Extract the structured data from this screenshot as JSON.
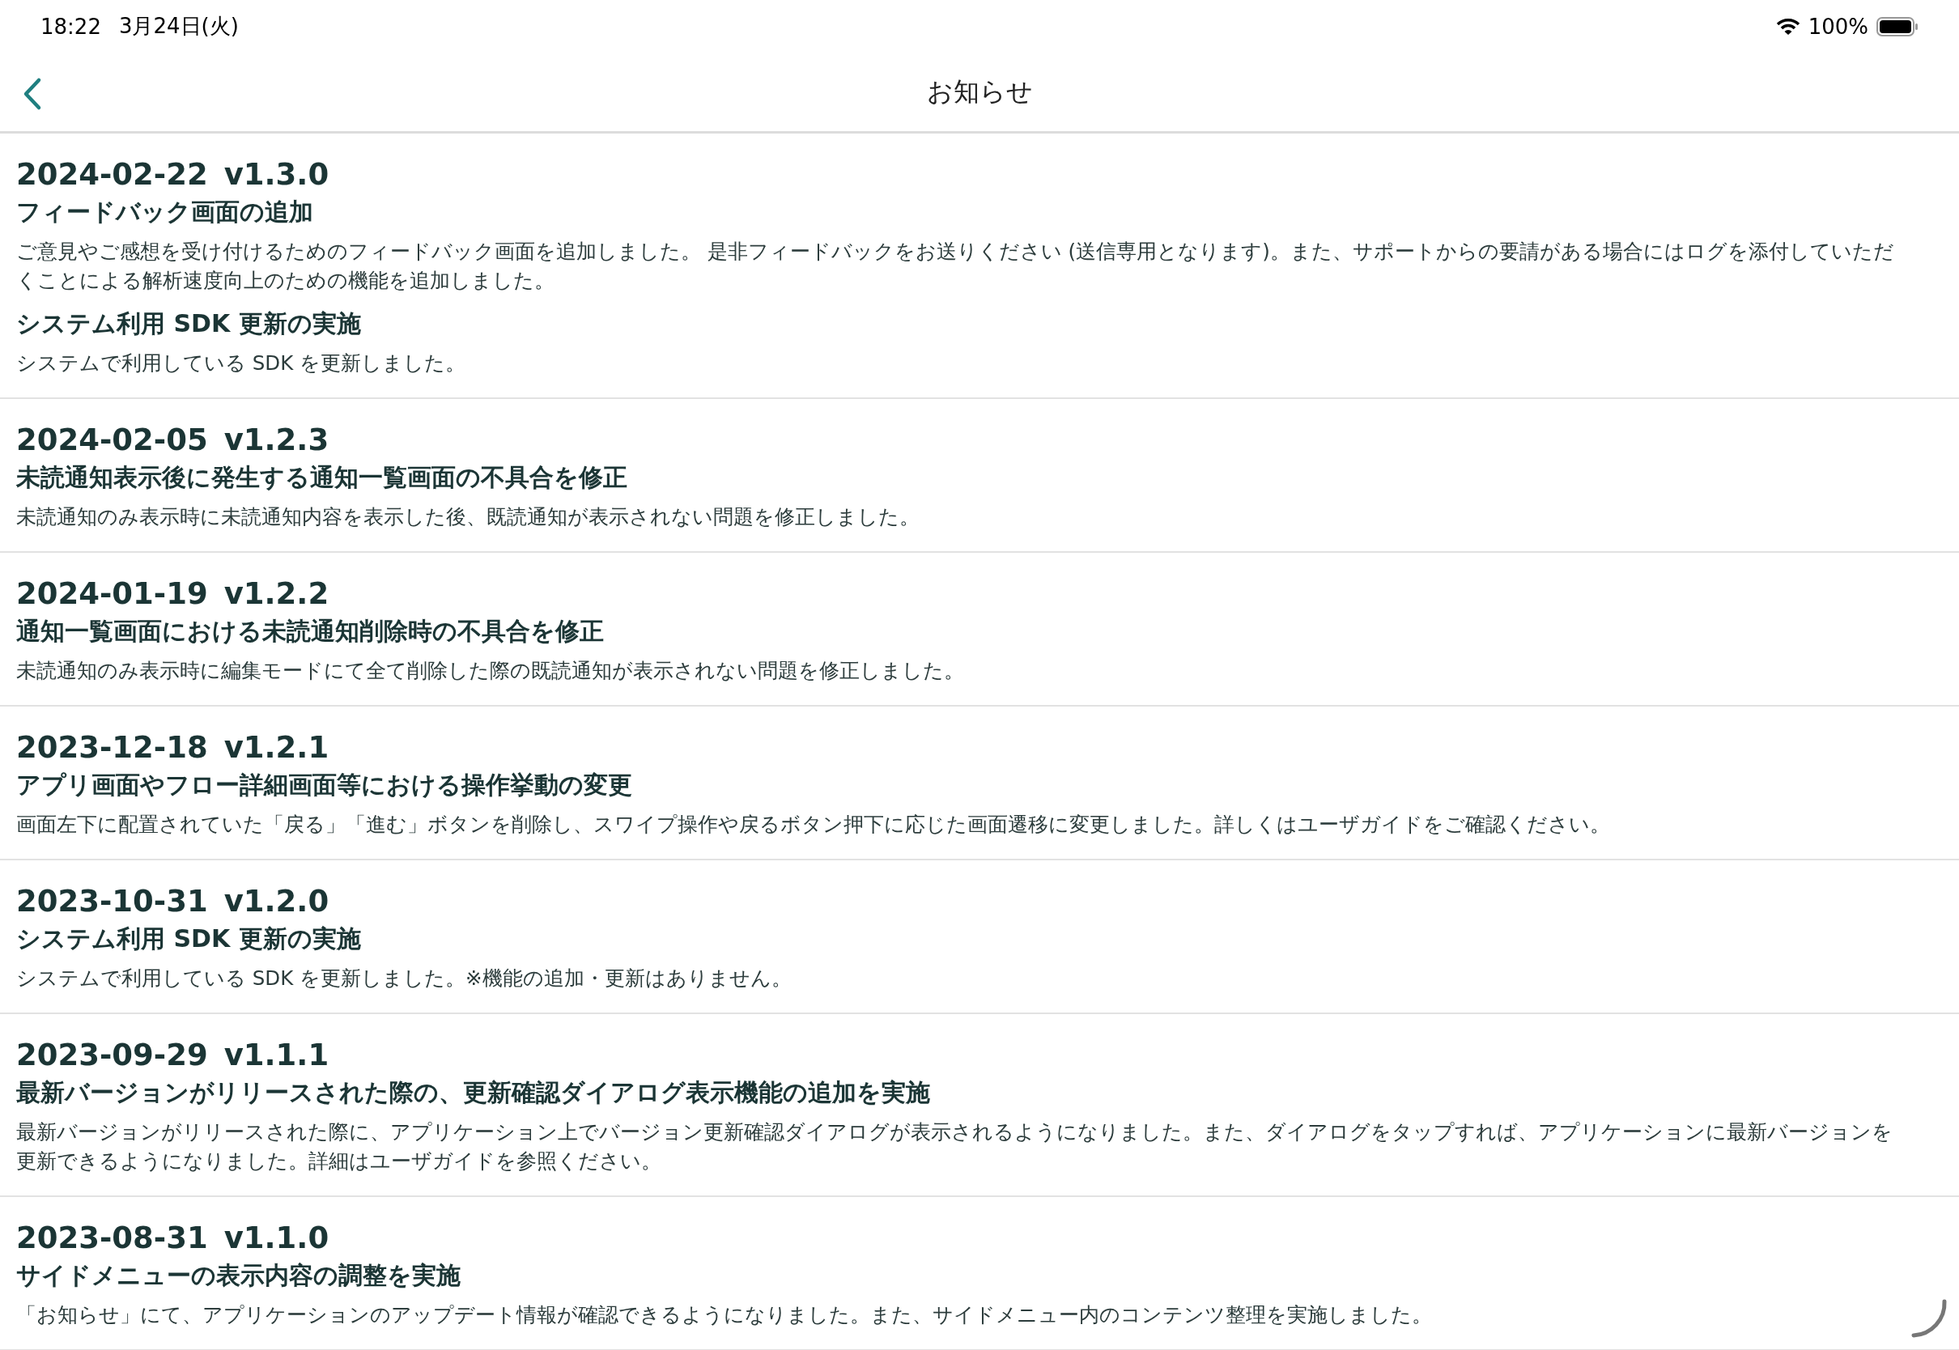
{
  "status_bar": {
    "time": "18:22",
    "date": "3月24日(火)",
    "battery": "100%"
  },
  "nav": {
    "title": "お知らせ"
  },
  "entries": [
    {
      "date": "2024-02-22",
      "version": "v1.3.0",
      "sections": [
        {
          "title": "フィードバック画面の追加",
          "body": "ご意見やご感想を受け付けるためのフィードバック画面を追加しました。 是非フィードバックをお送りください (送信専用となります)。また、サポートからの要請がある場合にはログを添付していただくことによる解析速度向上のための機能を追加しました。"
        },
        {
          "title": "システム利用 SDK 更新の実施",
          "body": "システムで利用している SDK を更新しました。"
        }
      ]
    },
    {
      "date": "2024-02-05",
      "version": "v1.2.3",
      "sections": [
        {
          "title": "未読通知表示後に発生する通知一覧画面の不具合を修正",
          "body": "未読通知のみ表示時に未読通知内容を表示した後、既読通知が表示されない問題を修正しました。"
        }
      ]
    },
    {
      "date": "2024-01-19",
      "version": "v1.2.2",
      "sections": [
        {
          "title": "通知一覧画面における未読通知削除時の不具合を修正",
          "body": "未読通知のみ表示時に編集モードにて全て削除した際の既読通知が表示されない問題を修正しました。"
        }
      ]
    },
    {
      "date": "2023-12-18",
      "version": "v1.2.1",
      "sections": [
        {
          "title": "アプリ画面やフロー詳細画面等における操作挙動の変更",
          "body": "画面左下に配置されていた「戻る」「進む」ボタンを削除し、スワイプ操作や戻るボタン押下に応じた画面遷移に変更しました。詳しくはユーザガイドをご確認ください。"
        }
      ]
    },
    {
      "date": "2023-10-31",
      "version": "v1.2.0",
      "sections": [
        {
          "title": "システム利用 SDK 更新の実施",
          "body": "システムで利用している SDK を更新しました。※機能の追加・更新はありません。"
        }
      ]
    },
    {
      "date": "2023-09-29",
      "version": "v1.1.1",
      "sections": [
        {
          "title": "最新バージョンがリリースされた際の、更新確認ダイアログ表示機能の追加を実施",
          "body": "最新バージョンがリリースされた際に、アプリケーション上でバージョン更新確認ダイアログが表示されるようになりました。また、ダイアログをタップすれば、アプリケーションに最新バージョンを更新できるようになりました。詳細はユーザガイドを参照ください。"
        }
      ]
    },
    {
      "date": "2023-08-31",
      "version": "v1.1.0",
      "sections": [
        {
          "title": "サイドメニューの表示内容の調整を実施",
          "body": "「お知らせ」にて、アプリケーションのアップデート情報が確認できるようになりました。また、サイドメニュー内のコンテンツ整理を実施しました。"
        }
      ]
    }
  ]
}
